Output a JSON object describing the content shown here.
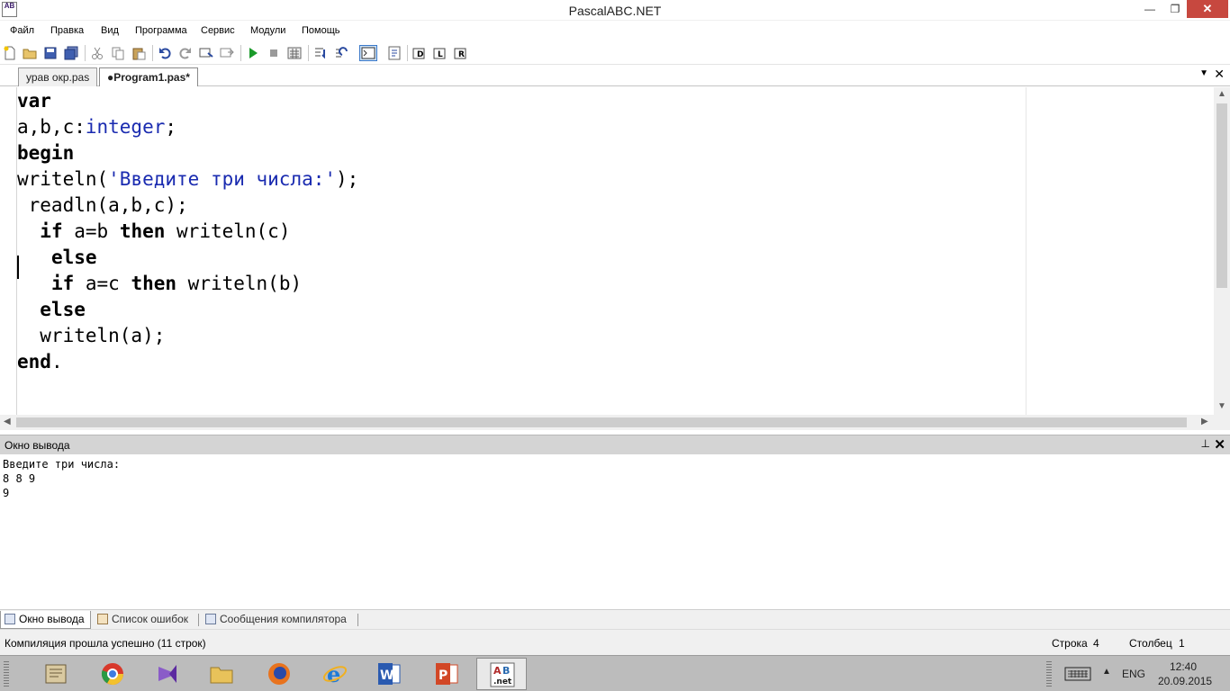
{
  "window": {
    "title": "PascalABC.NET",
    "icon_text": "AB",
    "minimize": "—",
    "maximize": "❐",
    "close": "✕"
  },
  "menu": [
    "Файл",
    "Правка",
    "Вид",
    "Программа",
    "Сервис",
    "Модули",
    "Помощь"
  ],
  "tabs": [
    {
      "label": "урав окр.pas",
      "active": false
    },
    {
      "label": "●Program1.pas*",
      "active": true
    }
  ],
  "tab_controls": {
    "menu": "▼",
    "close": "✕"
  },
  "editor": {
    "lines": [
      [
        {
          "t": "var",
          "c": "kw"
        }
      ],
      [
        {
          "t": "a,b,c:",
          "c": ""
        },
        {
          "t": "integer",
          "c": "ty"
        },
        {
          "t": ";",
          "c": ""
        }
      ],
      [
        {
          "t": "begin",
          "c": "kw"
        }
      ],
      [
        {
          "t": "writeln(",
          "c": ""
        },
        {
          "t": "'Введите три числа:'",
          "c": "st"
        },
        {
          "t": ");",
          "c": ""
        }
      ],
      [
        {
          "t": " readln(a,b,c);",
          "c": ""
        }
      ],
      [
        {
          "t": "  ",
          "c": ""
        },
        {
          "t": "if",
          "c": "kw"
        },
        {
          "t": " a=b ",
          "c": ""
        },
        {
          "t": "then",
          "c": "kw"
        },
        {
          "t": " writeln(c)",
          "c": ""
        }
      ],
      [
        {
          "t": "   ",
          "c": ""
        },
        {
          "t": "else",
          "c": "kw"
        }
      ],
      [
        {
          "t": "   ",
          "c": ""
        },
        {
          "t": "if",
          "c": "kw"
        },
        {
          "t": " a=c ",
          "c": ""
        },
        {
          "t": "then",
          "c": "kw"
        },
        {
          "t": " writeln(b)",
          "c": ""
        }
      ],
      [
        {
          "t": "  ",
          "c": ""
        },
        {
          "t": "else",
          "c": "kw"
        }
      ],
      [
        {
          "t": "  writeln(a);",
          "c": ""
        }
      ],
      [
        {
          "t": "end",
          "c": "kw"
        },
        {
          "t": ".",
          "c": ""
        }
      ]
    ]
  },
  "output_panel": {
    "title": "Окно вывода",
    "pin": "⊥",
    "close": "✕",
    "lines": [
      "Введите три числа:",
      "8 8 9",
      "9"
    ]
  },
  "bottom_tabs": [
    {
      "label": "Окно вывода",
      "active": true
    },
    {
      "label": "Список ошибок",
      "active": false
    },
    {
      "label": "Сообщения компилятора",
      "active": false
    }
  ],
  "status": {
    "message": "Компиляция прошла успешно (11 строк)",
    "row_label": "Строка",
    "row_value": "4",
    "col_label": "Столбец",
    "col_value": "1"
  },
  "taskbar": {
    "apps": [
      "file-manager",
      "chrome",
      "visual-studio",
      "folder",
      "firefox",
      "internet-explorer",
      "word",
      "powerpoint",
      "pascalabc"
    ],
    "lang": "ENG",
    "time": "12:40",
    "date": "20.09.2015"
  },
  "colors": {
    "accent": "#1a2bb0",
    "close_red": "#c7483f"
  }
}
